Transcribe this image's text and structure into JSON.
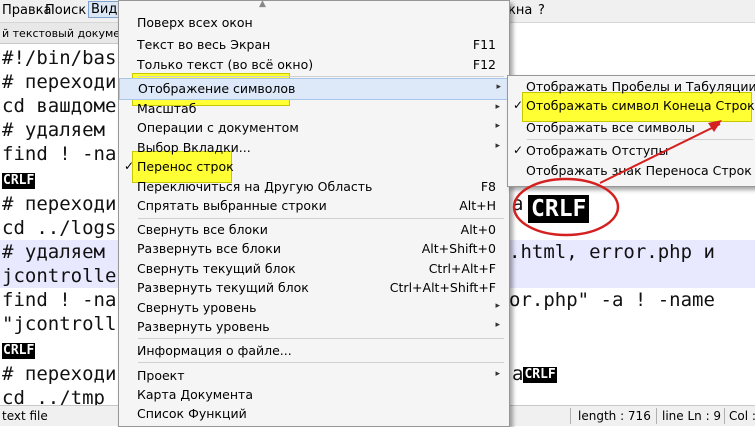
{
  "menubar": {
    "items": [
      "Правка",
      "Поиск",
      "Вид",
      "кна",
      "?"
    ]
  },
  "tab": {
    "label": "й текстовый документ"
  },
  "editor": {
    "lines": [
      "#!/bin/bas",
      "# переходи",
      "cd вашдоме",
      "# удаляем ",
      "find ! -na",
      "",
      "# переходи",
      "cd ../logs",
      "# удаляем ",
      "jcontrolle",
      "find ! -na",
      "\"jcontroll",
      "",
      "# переходи",
      "cd ../tmp"
    ],
    "right_fragments": {
      "r7": "a",
      "r9": ".html, error.php и",
      "r11": "or.php\" -a ! -name",
      "r14": "a"
    },
    "crlf": "CRLF"
  },
  "status": {
    "file_type": "text file",
    "length": "length : 716",
    "line": "line Ln : 9",
    "col": "Col :"
  },
  "view_menu": {
    "items": [
      {
        "label": "Поверх всех окон",
        "shortcut": ""
      },
      {
        "label": "Текст во весь Экран",
        "shortcut": "F11"
      },
      {
        "label": "Только текст (во всё окно)",
        "shortcut": "F12"
      },
      {
        "label": "Отображение символов",
        "shortcut": "",
        "submenu": true
      },
      {
        "label": "Масштаб",
        "shortcut": "",
        "submenu": true
      },
      {
        "label": "Операции с документом",
        "shortcut": "",
        "submenu": true
      },
      {
        "label": "Выбор Вкладки...",
        "shortcut": "",
        "submenu": true
      },
      {
        "label": "Перенос строк",
        "shortcut": "",
        "checked": true
      },
      {
        "label": "Переключиться на Другую Область",
        "shortcut": "F8"
      },
      {
        "label": "Спрятать выбранные строки",
        "shortcut": "Alt+H"
      },
      {
        "label": "Свернуть все блоки",
        "shortcut": "Alt+0"
      },
      {
        "label": "Развернуть все блоки",
        "shortcut": "Alt+Shift+0"
      },
      {
        "label": "Свернуть текущий блок",
        "shortcut": "Ctrl+Alt+F"
      },
      {
        "label": "Развернуть текущий блок",
        "shortcut": "Ctrl+Alt+Shift+F"
      },
      {
        "label": "Свернуть уровень",
        "shortcut": "",
        "submenu": true
      },
      {
        "label": "Развернуть уровень",
        "shortcut": "",
        "submenu": true
      },
      {
        "label": "Информация о файле...",
        "shortcut": ""
      },
      {
        "label": "Проект",
        "shortcut": "",
        "submenu": true
      },
      {
        "label": "Карта Документа",
        "shortcut": ""
      },
      {
        "label": "Список Функций",
        "shortcut": ""
      }
    ]
  },
  "symbols_submenu": {
    "items": [
      {
        "label": "Отображать Пробелы и Табуляции",
        "checked": false
      },
      {
        "label": "Отображать символ Конеца Строки",
        "checked": true
      },
      {
        "label": "Отображать все символы",
        "checked": false
      },
      {
        "label": "Отображать Отступы",
        "checked": true
      },
      {
        "label": "Отображать знак Переноса Строк",
        "checked": false
      }
    ]
  },
  "colors": {
    "highlight": "#ffff33",
    "annotation": "#d42020",
    "menu_hover": "#dde9f8"
  }
}
